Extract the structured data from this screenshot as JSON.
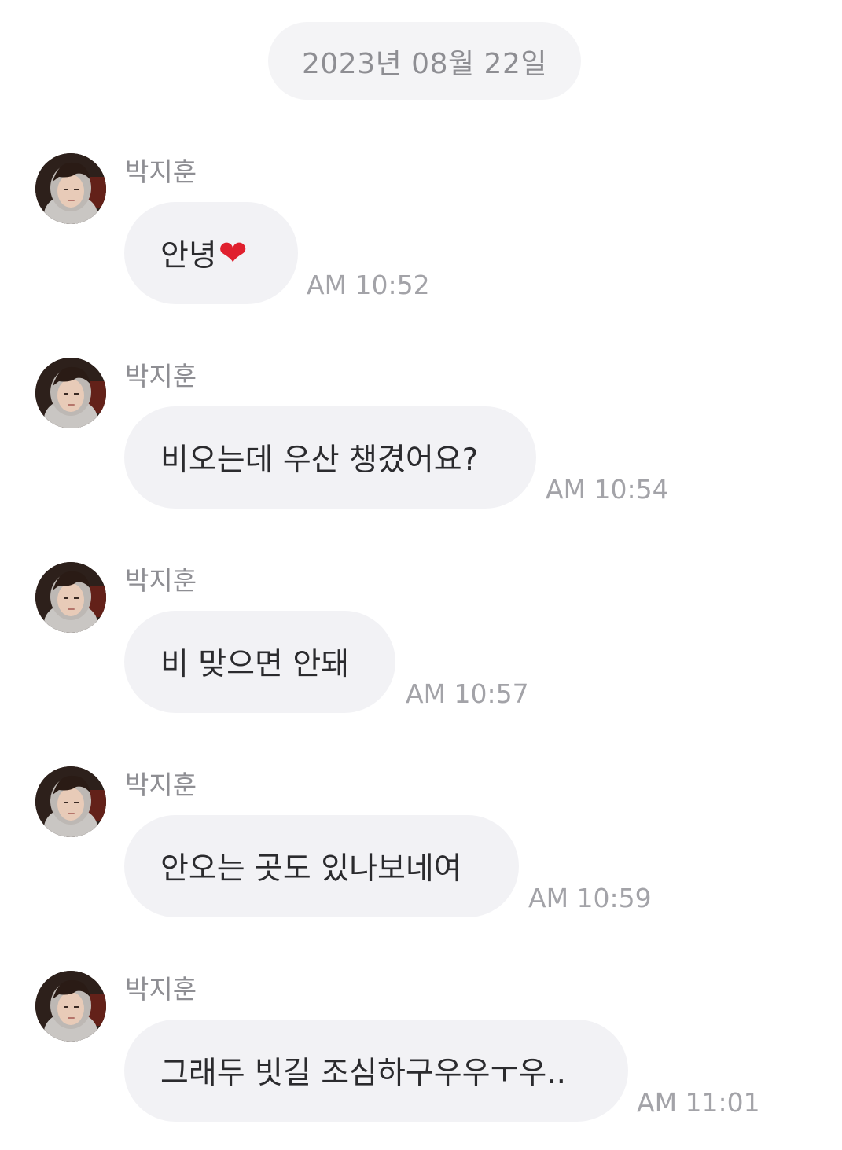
{
  "date_header": "2023년 08월 22일",
  "messages": [
    {
      "sender": "박지훈",
      "text": "안녕",
      "emoji": "❤",
      "time": "AM 10:52"
    },
    {
      "sender": "박지훈",
      "text": "비오는데 우산 챙겼어요?",
      "time": "AM 10:54"
    },
    {
      "sender": "박지훈",
      "text": "비 맞으면 안돼",
      "time": "AM 10:57"
    },
    {
      "sender": "박지훈",
      "text": "안오는 곳도 있나보네여",
      "time": "AM 10:59"
    },
    {
      "sender": "박지훈",
      "text": "그래두 빗길 조심하구우우ㅜ우..",
      "time": "AM 11:01"
    }
  ],
  "colors": {
    "background": "#ffffff",
    "bubble": "#f2f2f5",
    "date_pill": "#f4f4f6",
    "text": "#2b2b2e",
    "muted": "#8e8e93",
    "heart": "#e0202e"
  }
}
